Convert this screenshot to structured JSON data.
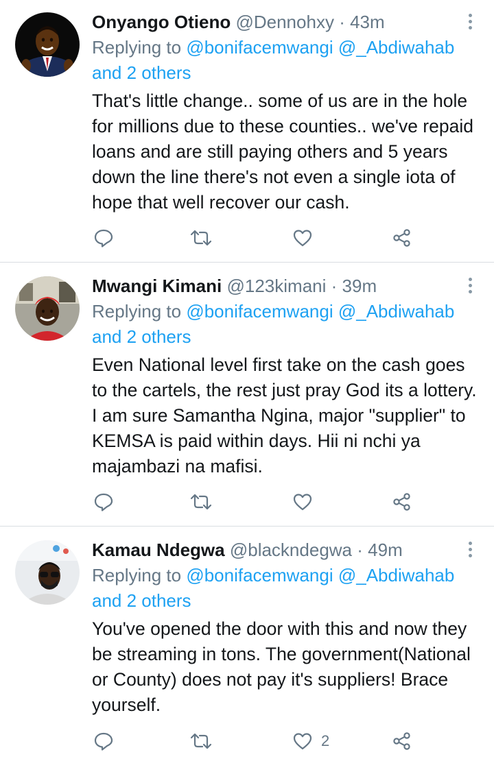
{
  "tweets": [
    {
      "name": "Onyango Otieno",
      "handle": "@Dennohxy",
      "separator": "·",
      "time": "43m",
      "replying_prefix": "Replying to",
      "replying_users": [
        "@bonifacemwangi",
        "@_Abdiwahab"
      ],
      "replying_others": "and 2 others",
      "text": "That's little change.. some of us are in the hole for millions due to these counties.. we've repaid loans and are still paying others and 5 years down the line there's not even a single iota of hope that well recover our cash.",
      "like_count": "",
      "icons": {
        "reply": "reply-icon",
        "retweet": "retweet-icon",
        "like": "heart-icon",
        "share": "share-icon",
        "more": "more-options-icon"
      }
    },
    {
      "name": "Mwangi Kimani",
      "handle": "@123kimani",
      "separator": "·",
      "time": "39m",
      "replying_prefix": "Replying to",
      "replying_users": [
        "@bonifacemwangi",
        "@_Abdiwahab"
      ],
      "replying_others": "and 2 others",
      "text": "Even National level first take on the cash goes to the cartels, the rest just pray God its a lottery. I am sure Samantha Ngina, major \"supplier\" to KEMSA is paid within days. Hii ni nchi ya majambazi na mafisi.",
      "like_count": "",
      "icons": {
        "reply": "reply-icon",
        "retweet": "retweet-icon",
        "like": "heart-icon",
        "share": "share-icon",
        "more": "more-options-icon"
      }
    },
    {
      "name": "Kamau Ndegwa",
      "handle": "@blackndegwa",
      "separator": "·",
      "time": "49m",
      "replying_prefix": "Replying to",
      "replying_users": [
        "@bonifacemwangi",
        "@_Abdiwahab"
      ],
      "replying_others": "and 2 others",
      "text": "You've opened the door with this and now they be streaming in tons. The government(National or County) does not pay it's suppliers! Brace yourself.",
      "like_count": "2",
      "icons": {
        "reply": "reply-icon",
        "retweet": "retweet-icon",
        "like": "heart-icon",
        "share": "share-icon",
        "more": "more-options-icon"
      }
    }
  ],
  "colors": {
    "link": "#1da1f2",
    "secondary_text": "#657786",
    "primary_text": "#14171a",
    "divider": "#d9dde1",
    "icon": "#657786"
  }
}
